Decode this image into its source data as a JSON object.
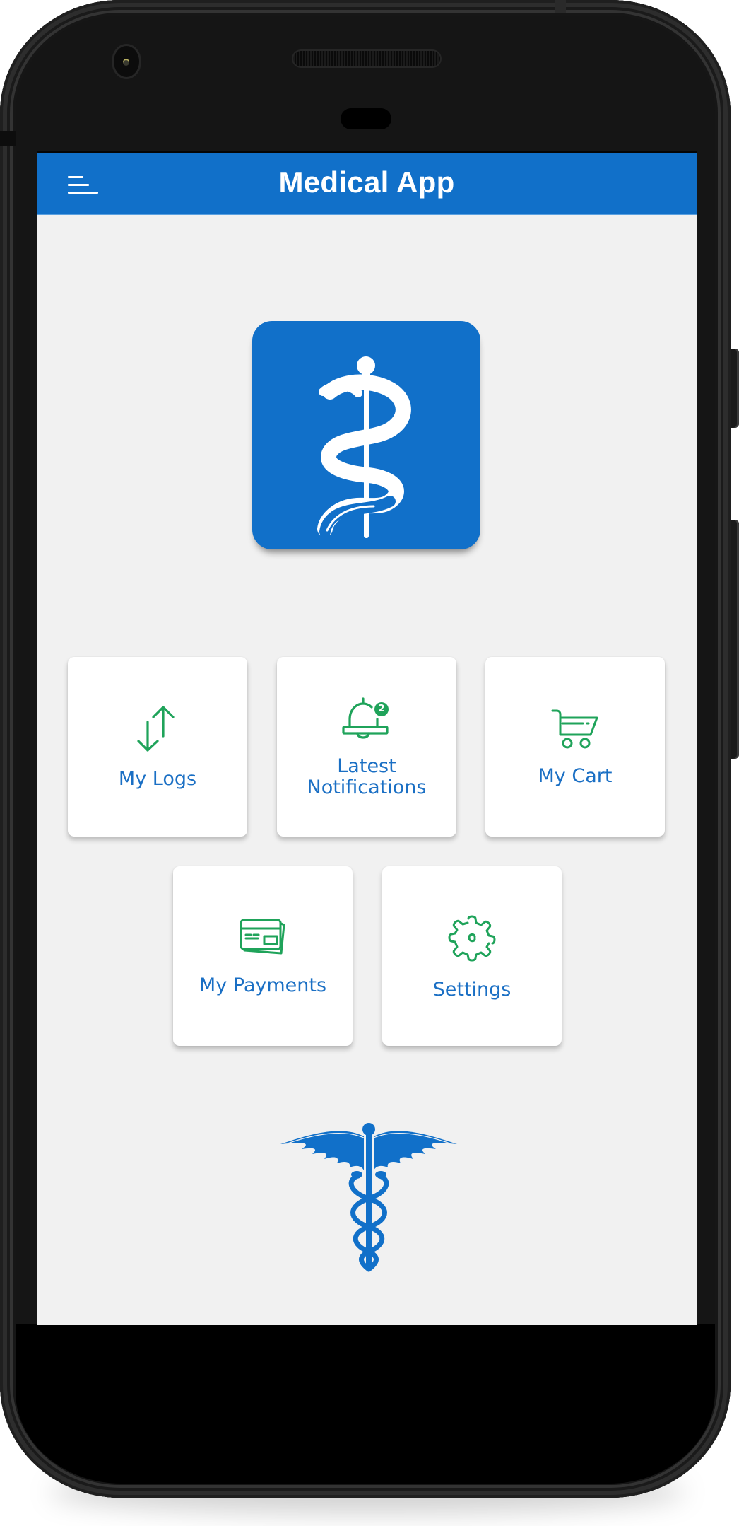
{
  "app": {
    "title": "Medical App",
    "accent_color": "#1170c9",
    "icon_color": "#1fa35a",
    "label_color": "#1a6fc4"
  },
  "header": {
    "menu_icon": "hamburger-menu-icon",
    "title": "Medical App"
  },
  "logo": {
    "icon": "rod-of-asclepius-icon"
  },
  "menu_tiles": [
    {
      "label": "My Logs",
      "icon": "arrows-up-down-icon"
    },
    {
      "label_line1": "Latest",
      "label_line2": "Notifications",
      "icon": "bell-icon",
      "badge": "2"
    },
    {
      "label": "My Cart",
      "icon": "shopping-cart-icon"
    },
    {
      "label": "My Payments",
      "icon": "credit-cards-icon"
    },
    {
      "label": "Settings",
      "icon": "gear-icon"
    }
  ],
  "footer_emblem": {
    "icon": "caduceus-icon"
  }
}
